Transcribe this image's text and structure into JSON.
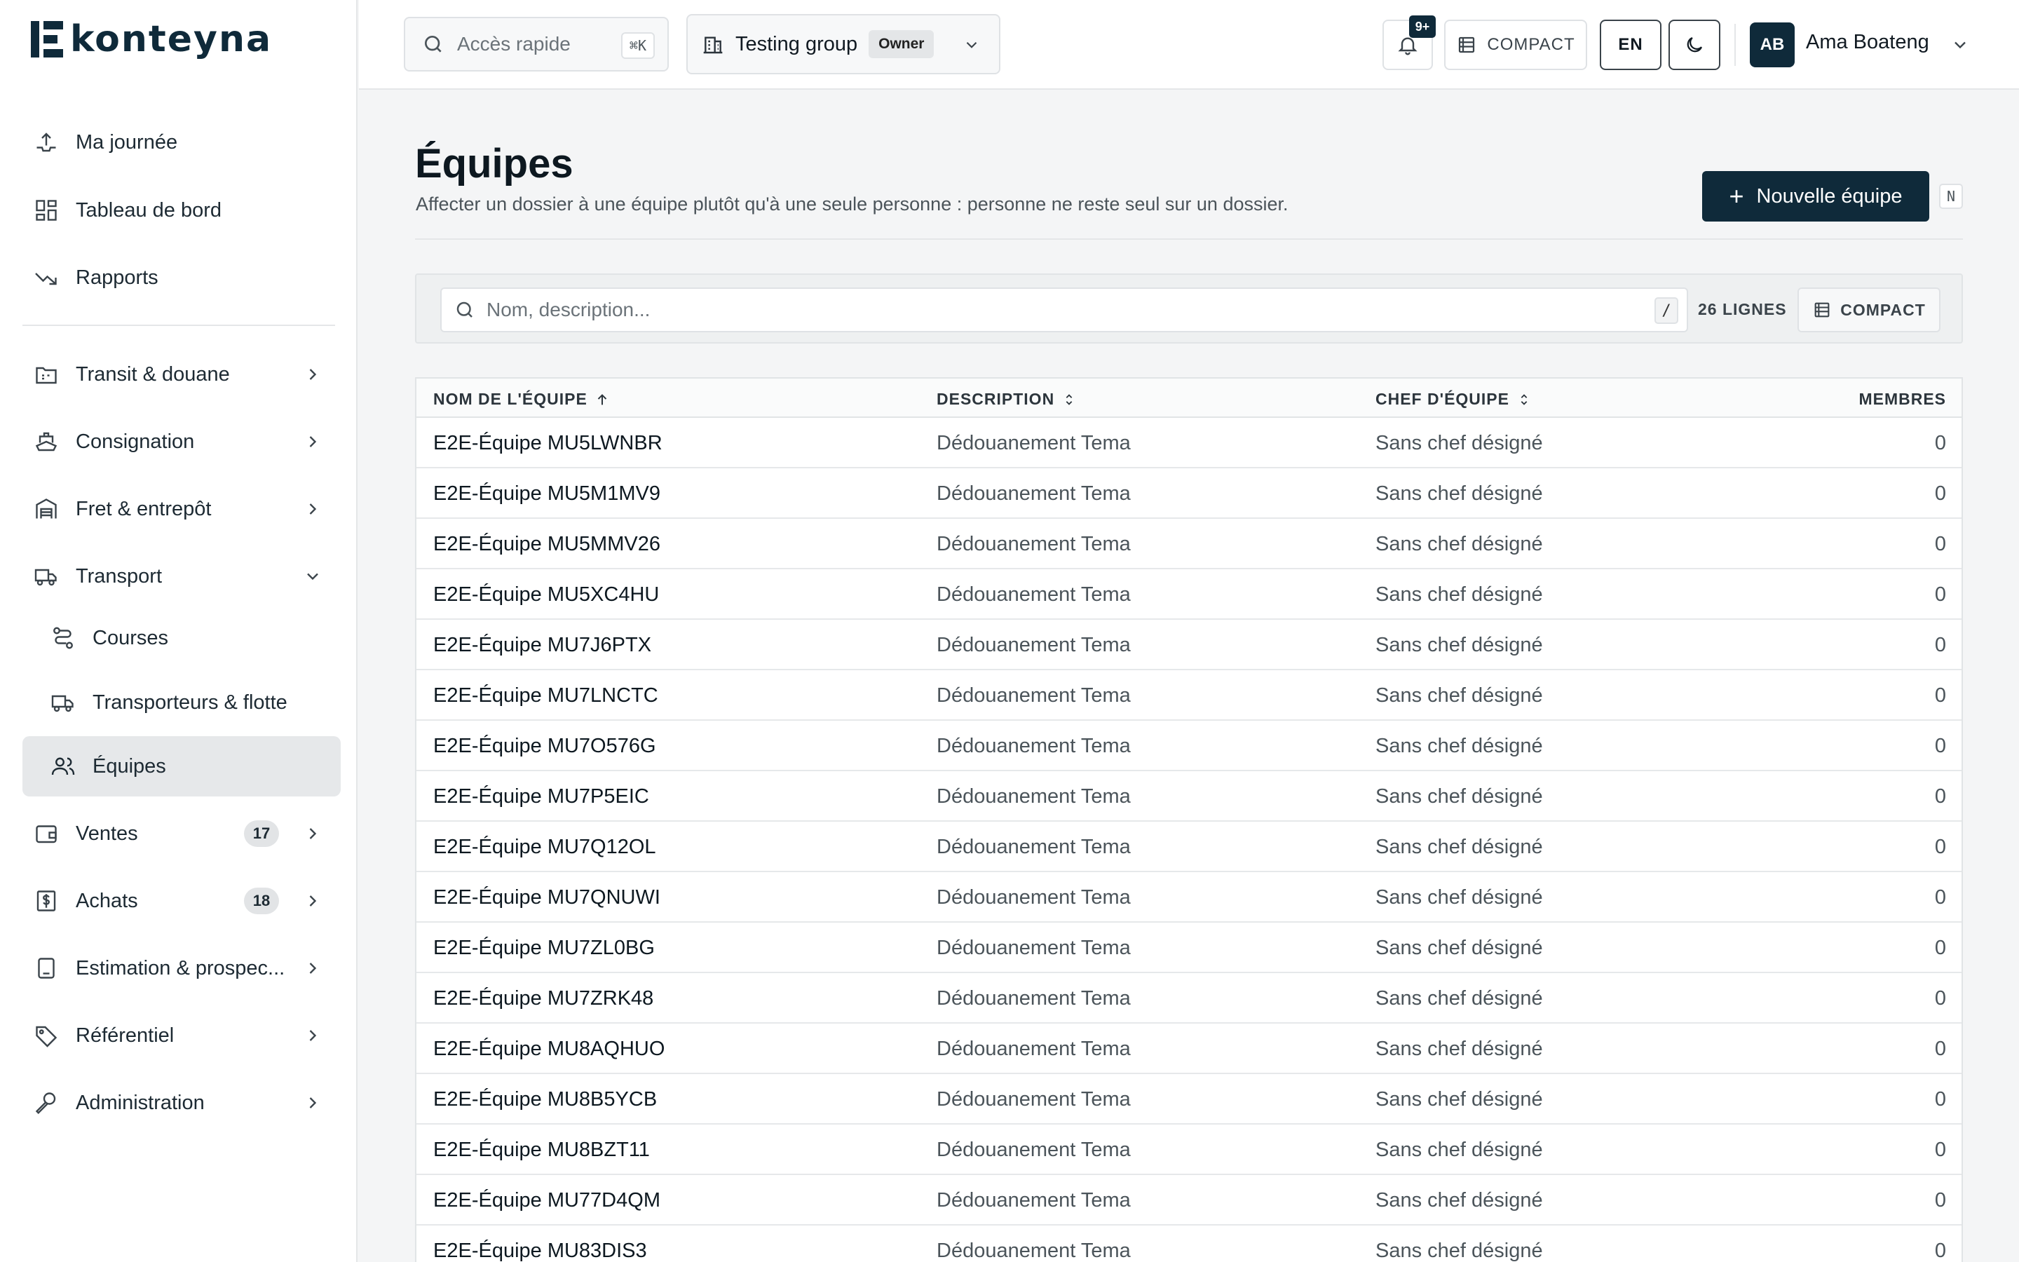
{
  "brand": {
    "name": "konteyna"
  },
  "sidebar": {
    "items": [
      {
        "label": "Ma journée",
        "icon": "upload-tray-icon"
      },
      {
        "label": "Tableau de bord",
        "icon": "dashboard-grid-icon"
      },
      {
        "label": "Rapports",
        "icon": "trend-down-icon"
      },
      {
        "label": "Transit & douane",
        "icon": "customs-icon"
      },
      {
        "label": "Consignation",
        "icon": "ship-icon"
      },
      {
        "label": "Fret & entrepôt",
        "icon": "warehouse-icon"
      },
      {
        "label": "Transport",
        "icon": "truck-icon"
      },
      {
        "label": "Courses",
        "icon": "route-icon"
      },
      {
        "label": "Transporteurs & flotte",
        "icon": "truck-icon"
      },
      {
        "label": "Équipes",
        "icon": "users-icon"
      },
      {
        "label": "Ventes",
        "icon": "wallet-icon",
        "badge": "17"
      },
      {
        "label": "Achats",
        "icon": "dollar-receipt-icon",
        "badge": "18"
      },
      {
        "label": "Estimation & prospec...",
        "icon": "calculator-icon"
      },
      {
        "label": "Référentiel",
        "icon": "tag-icon"
      },
      {
        "label": "Administration",
        "icon": "wrench-icon"
      }
    ]
  },
  "topbar": {
    "quick_access": "Accès rapide",
    "quick_shortcut": "⌘K",
    "group_name": "Testing group",
    "group_role": "Owner",
    "notifications_count": "9+",
    "compact_label": "COMPACT",
    "lang": "EN",
    "user_initials": "AB",
    "user_name": "Ama Boateng"
  },
  "page": {
    "title": "Équipes",
    "subtitle": "Affecter un dossier à une équipe plutôt qu'à une seule personne : personne ne reste seul sur un dossier.",
    "new_button": "Nouvelle équipe",
    "new_shortcut": "N"
  },
  "filters": {
    "search_placeholder": "Nom, description...",
    "search_shortcut": "/",
    "rows_count": "26 LIGNES",
    "compact_label": "COMPACT"
  },
  "table": {
    "columns": [
      "NOM DE L'ÉQUIPE",
      "DESCRIPTION",
      "CHEF D'ÉQUIPE",
      "MEMBRES"
    ],
    "rows": [
      {
        "name": "E2E-Équipe MU5LWNBR",
        "description": "Dédouanement Tema",
        "lead": "Sans chef désigné",
        "members": "0"
      },
      {
        "name": "E2E-Équipe MU5M1MV9",
        "description": "Dédouanement Tema",
        "lead": "Sans chef désigné",
        "members": "0"
      },
      {
        "name": "E2E-Équipe MU5MMV26",
        "description": "Dédouanement Tema",
        "lead": "Sans chef désigné",
        "members": "0"
      },
      {
        "name": "E2E-Équipe MU5XC4HU",
        "description": "Dédouanement Tema",
        "lead": "Sans chef désigné",
        "members": "0"
      },
      {
        "name": "E2E-Équipe MU7J6PTX",
        "description": "Dédouanement Tema",
        "lead": "Sans chef désigné",
        "members": "0"
      },
      {
        "name": "E2E-Équipe MU7LNCTC",
        "description": "Dédouanement Tema",
        "lead": "Sans chef désigné",
        "members": "0"
      },
      {
        "name": "E2E-Équipe MU7O576G",
        "description": "Dédouanement Tema",
        "lead": "Sans chef désigné",
        "members": "0"
      },
      {
        "name": "E2E-Équipe MU7P5EIC",
        "description": "Dédouanement Tema",
        "lead": "Sans chef désigné",
        "members": "0"
      },
      {
        "name": "E2E-Équipe MU7Q12OL",
        "description": "Dédouanement Tema",
        "lead": "Sans chef désigné",
        "members": "0"
      },
      {
        "name": "E2E-Équipe MU7QNUWI",
        "description": "Dédouanement Tema",
        "lead": "Sans chef désigné",
        "members": "0"
      },
      {
        "name": "E2E-Équipe MU7ZL0BG",
        "description": "Dédouanement Tema",
        "lead": "Sans chef désigné",
        "members": "0"
      },
      {
        "name": "E2E-Équipe MU7ZRK48",
        "description": "Dédouanement Tema",
        "lead": "Sans chef désigné",
        "members": "0"
      },
      {
        "name": "E2E-Équipe MU8AQHUO",
        "description": "Dédouanement Tema",
        "lead": "Sans chef désigné",
        "members": "0"
      },
      {
        "name": "E2E-Équipe MU8B5YCB",
        "description": "Dédouanement Tema",
        "lead": "Sans chef désigné",
        "members": "0"
      },
      {
        "name": "E2E-Équipe MU8BZT11",
        "description": "Dédouanement Tema",
        "lead": "Sans chef désigné",
        "members": "0"
      },
      {
        "name": "E2E-Équipe MU77D4QM",
        "description": "Dédouanement Tema",
        "lead": "Sans chef désigné",
        "members": "0"
      },
      {
        "name": "E2E-Équipe MU83DIS3",
        "description": "Dédouanement Tema",
        "lead": "Sans chef désigné",
        "members": "0"
      }
    ]
  },
  "colors": {
    "accent": "#0f2a3a",
    "active_bg": "#e6e8ea",
    "page_bg": "#f4f5f6"
  }
}
